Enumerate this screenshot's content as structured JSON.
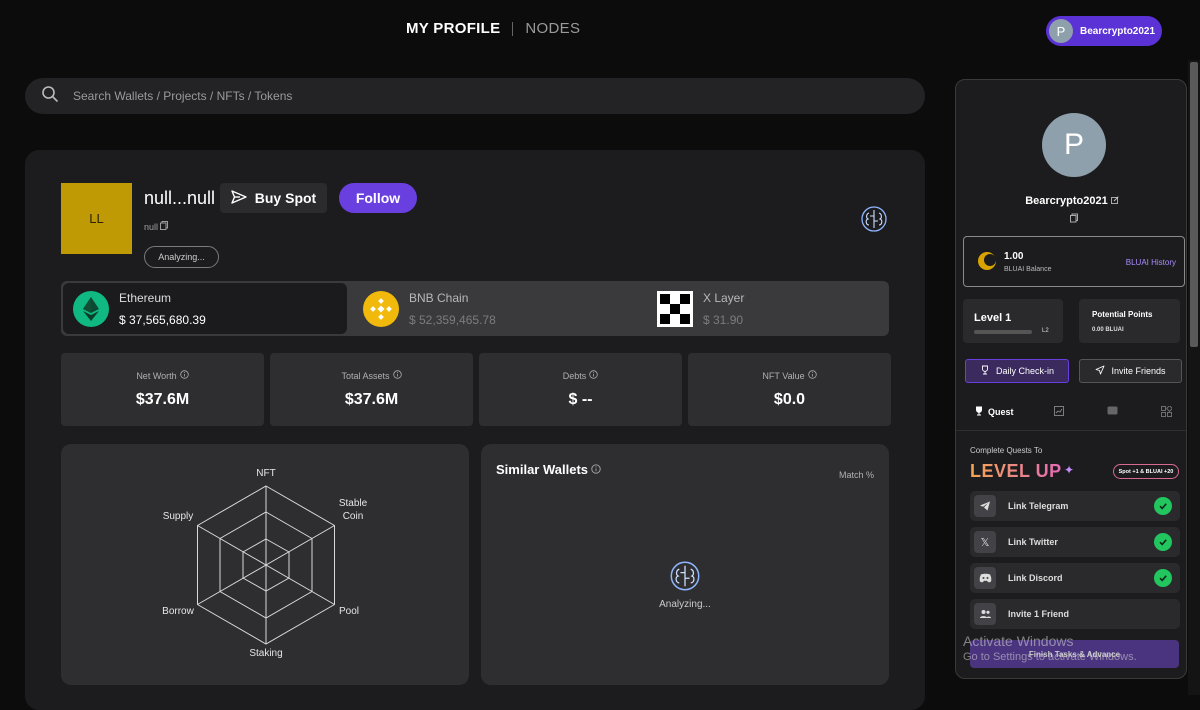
{
  "nav": {
    "tabs": [
      "MY PROFILE",
      "NODES"
    ],
    "user": {
      "initial": "P",
      "name": "Bearcrypto2021"
    }
  },
  "search": {
    "placeholder": "Search Wallets / Projects / NFTs / Tokens"
  },
  "wallet": {
    "avatar_text": "LL",
    "name": "null...null",
    "sub": "null",
    "buy_label": "Buy Spot",
    "follow_label": "Follow",
    "status": "Analyzing..."
  },
  "chains": [
    {
      "name": "Ethereum",
      "value": "$ 37,565,680.39",
      "icon": "ethereum-icon",
      "active": true
    },
    {
      "name": "BNB Chain",
      "value": "$ 52,359,465.78",
      "icon": "bnb-icon",
      "active": false
    },
    {
      "name": "X Layer",
      "value": "$ 31.90",
      "icon": "xlayer-icon",
      "active": false
    }
  ],
  "stats": [
    {
      "label": "Net Worth",
      "value": "$37.6M"
    },
    {
      "label": "Total Assets",
      "value": "$37.6M"
    },
    {
      "label": "Debts",
      "value": "$ --"
    },
    {
      "label": "NFT Value",
      "value": "$0.0"
    }
  ],
  "radar": {
    "axes": [
      "NFT",
      "Stable Coin",
      "Pool",
      "Staking",
      "Borrow",
      "Supply"
    ]
  },
  "similar": {
    "title": "Similar Wallets",
    "match_label": "Match %",
    "status": "Analyzing..."
  },
  "sidebar": {
    "avatar_initial": "P",
    "username": "Bearcrypto2021",
    "balance": {
      "value": "1.00",
      "label": "BLUAI Balance",
      "history_link": "BLUAI History"
    },
    "level": {
      "title": "Level 1",
      "next": "L2",
      "progress": 0
    },
    "points": {
      "title": "Potential Points",
      "value": "0.00 BLUAI"
    },
    "daily_checkin": "Daily Check-in",
    "invite_friends": "Invite Friends",
    "tabs": [
      "Quest"
    ],
    "quest_intro": "Complete Quests To",
    "level_up": "LEVEL UP",
    "bonus": "Spot +1 & BLUAI +20",
    "quests": [
      {
        "label": "Link Telegram",
        "done": true
      },
      {
        "label": "Link Twitter",
        "done": true
      },
      {
        "label": "Link Discord",
        "done": true
      },
      {
        "label": "Invite 1 Friend",
        "done": false
      }
    ],
    "finish_button": "Finish Tasks & Advance"
  },
  "watermark": {
    "line1": "Activate Windows",
    "line2": "Go to Settings to activate Windows."
  },
  "colors": {
    "accent": "#6a3fe0",
    "success": "#22c55e",
    "wallet_avatar": "#c09a05"
  }
}
